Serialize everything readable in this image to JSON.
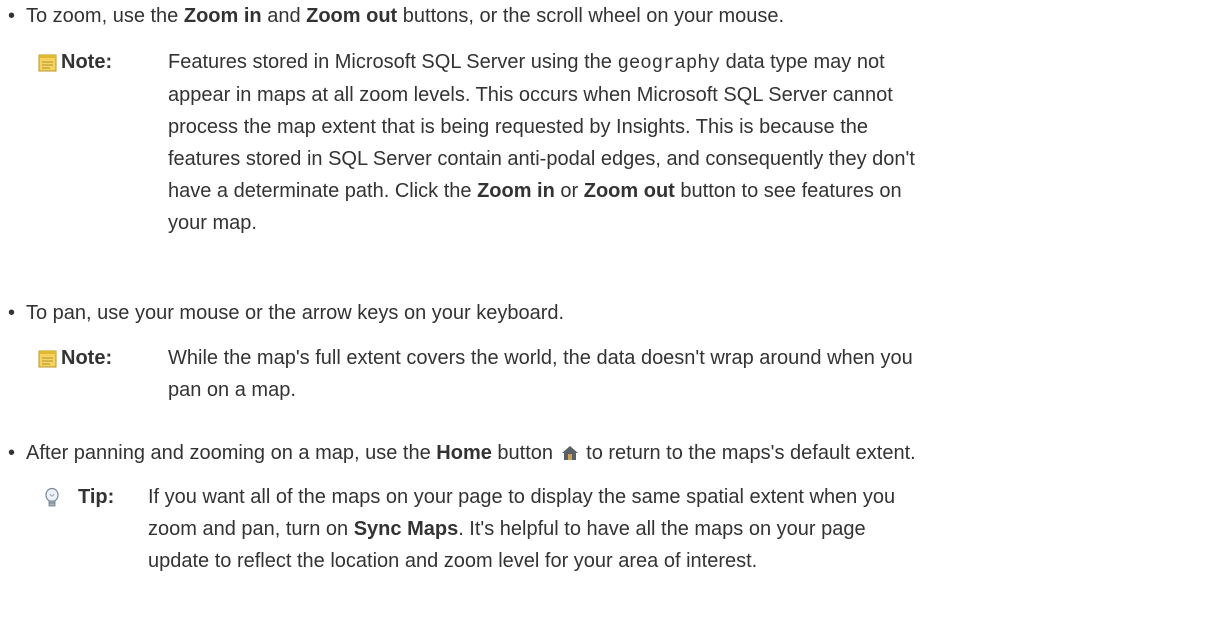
{
  "bullets": [
    {
      "pre": "To zoom, use the ",
      "b1": "Zoom in",
      "mid": " and ",
      "b2": "Zoom out",
      "post": " buttons, or the scroll wheel on your mouse."
    },
    {
      "text": "To pan, use your mouse or the arrow keys on your keyboard."
    },
    {
      "pre": "After panning and zooming on a map, use the ",
      "b1": "Home",
      "mid": " button ",
      "post": " to return to the maps's default extent."
    }
  ],
  "notes": [
    {
      "label": "Note:",
      "icon": "note-icon",
      "lines": [
        {
          "pre": "Features stored in Microsoft SQL Server using the ",
          "code": "geography",
          "post": " data type may not"
        },
        {
          "text": "appear in maps at all zoom levels. This occurs when Microsoft SQL Server cannot"
        },
        {
          "text": "process the map extent that is being requested by Insights. This is because the"
        },
        {
          "text": "features stored in SQL Server contain anti-podal edges, and consequently they don't"
        },
        {
          "pre": "have a determinate path. Click the ",
          "b1": "Zoom in",
          "mid": " or ",
          "b2": "Zoom out",
          "post": " button to see features on"
        },
        {
          "text": "your map."
        }
      ]
    },
    {
      "label": "Note:",
      "icon": "note-icon",
      "lines": [
        {
          "text": "While the map's full extent covers the world, the data doesn't wrap around when you"
        },
        {
          "text": "pan on a map."
        }
      ]
    },
    {
      "label": "Tip:",
      "icon": "lightbulb-icon",
      "lines": [
        {
          "text": "If you want all of the maps on your page to display the same spatial extent when you"
        },
        {
          "pre": "zoom and pan, turn on ",
          "b1": "Sync Maps",
          "post": ". It's helpful to have all the maps on your page"
        },
        {
          "text": "update to reflect the location and zoom level for your area of interest."
        }
      ]
    }
  ],
  "colors": {
    "text": "#333333",
    "note_icon": "#e8c23a",
    "tip_icon": "#7a8a9a"
  }
}
